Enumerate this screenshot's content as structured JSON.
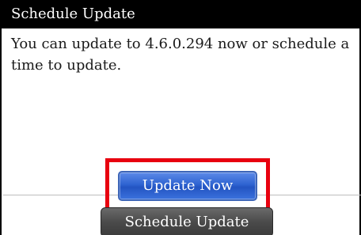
{
  "dialog": {
    "title": "Schedule Update",
    "message": "You can update to 4.6.0.294 now or schedule a time to update.",
    "buttons": {
      "update_now": "Update Now",
      "schedule_update": "Schedule Update"
    }
  },
  "colors": {
    "title_bar": "#000000",
    "update_button": "#2e63d1",
    "schedule_button": "#4a4a4a",
    "highlight": "#e8000f"
  }
}
